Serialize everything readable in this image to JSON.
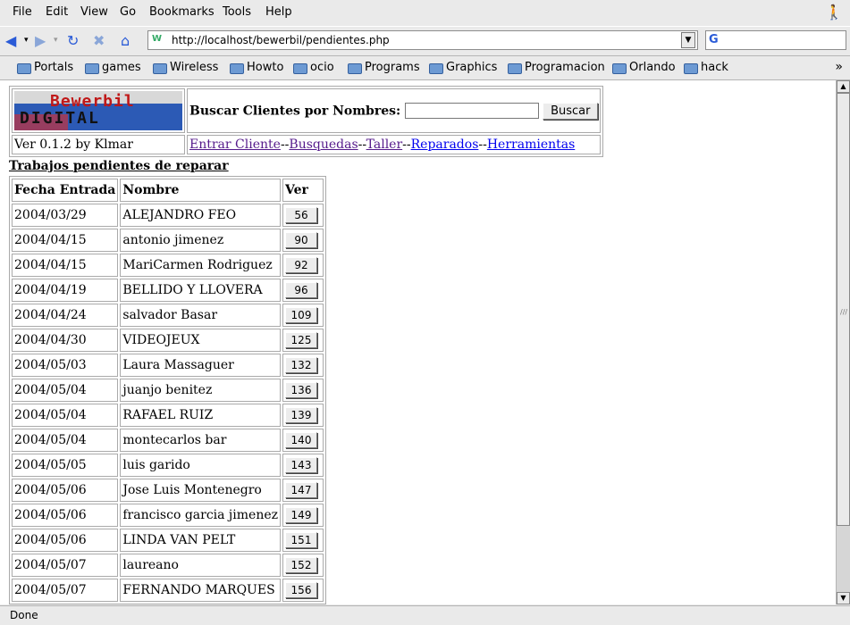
{
  "menu": [
    "File",
    "Edit",
    "View",
    "Go",
    "Bookmarks",
    "Tools",
    "Help"
  ],
  "url": "http://localhost/bewerbil/pendientes.php",
  "bookmarks": [
    "Portals",
    "games",
    "Wireless",
    "Howto",
    "ocio",
    "Programs",
    "Graphics",
    "Programacion",
    "Orlando",
    "hack"
  ],
  "logo": {
    "line1": "Bewerbil",
    "line2": "DIGITAL"
  },
  "search": {
    "label": "Buscar Clientes por Nombres:",
    "button": "Buscar",
    "value": ""
  },
  "version": "Ver 0.1.2 by Klmar",
  "nav": {
    "entrar": "Entrar Cliente",
    "busquedas": "Busquedas",
    "taller": "Taller",
    "reparados": "Reparados",
    "herramientas": "Herramientas",
    "sep": "--"
  },
  "section_title": "Trabajos pendientes de reparar",
  "table": {
    "headers": [
      "Fecha Entrada",
      "Nombre",
      "Ver"
    ],
    "rows": [
      {
        "fecha": "2004/03/29",
        "nombre": "ALEJANDRO FEO",
        "ver": "56"
      },
      {
        "fecha": "2004/04/15",
        "nombre": "antonio jimenez",
        "ver": "90"
      },
      {
        "fecha": "2004/04/15",
        "nombre": "MariCarmen Rodriguez",
        "ver": "92"
      },
      {
        "fecha": "2004/04/19",
        "nombre": "BELLIDO Y LLOVERA",
        "ver": "96"
      },
      {
        "fecha": "2004/04/24",
        "nombre": "salvador Basar",
        "ver": "109"
      },
      {
        "fecha": "2004/04/30",
        "nombre": "VIDEOJEUX",
        "ver": "125"
      },
      {
        "fecha": "2004/05/03",
        "nombre": "Laura Massaguer",
        "ver": "132"
      },
      {
        "fecha": "2004/05/04",
        "nombre": "juanjo benitez",
        "ver": "136"
      },
      {
        "fecha": "2004/05/04",
        "nombre": "RAFAEL RUIZ",
        "ver": "139"
      },
      {
        "fecha": "2004/05/04",
        "nombre": "montecarlos bar",
        "ver": "140"
      },
      {
        "fecha": "2004/05/05",
        "nombre": "luis garido",
        "ver": "143"
      },
      {
        "fecha": "2004/05/06",
        "nombre": "Jose Luis Montenegro",
        "ver": "147"
      },
      {
        "fecha": "2004/05/06",
        "nombre": "francisco garcia jimenez",
        "ver": "149"
      },
      {
        "fecha": "2004/05/06",
        "nombre": "LINDA VAN PELT",
        "ver": "151"
      },
      {
        "fecha": "2004/05/07",
        "nombre": "laureano",
        "ver": "152"
      },
      {
        "fecha": "2004/05/07",
        "nombre": "FERNANDO MARQUES",
        "ver": "156"
      }
    ]
  },
  "status": "Done"
}
